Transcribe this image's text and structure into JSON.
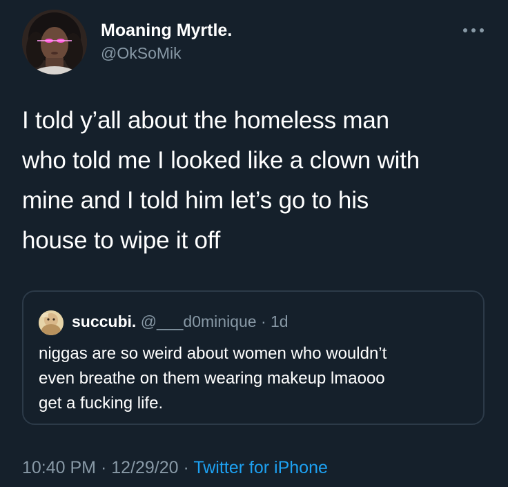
{
  "tweet": {
    "author_name": "Moaning Myrtle.",
    "author_handle": "@OkSoMik",
    "text_lines": [
      "I told y’all about the homeless man",
      "who told me I looked like a clown with",
      "mine and I told him let’s go to his",
      "house to wipe it off"
    ],
    "more_icon": "more-horizontal-icon",
    "timestamp_time": "10:40 PM",
    "separator": "·",
    "timestamp_date": "12/29/20",
    "source": "Twitter for iPhone"
  },
  "quoted": {
    "author_name": "succubi.",
    "author_handle": "@___d0minique",
    "separator": "·",
    "time": "1d",
    "text_lines": [
      "niggas are so weird about women who wouldn’t",
      "even breathe on them wearing makeup lmaooo",
      "get a fucking life."
    ]
  },
  "colors": {
    "background": "#15202b",
    "primary_text": "#ffffff",
    "secondary_text": "#8899a6",
    "link": "#1da1f2",
    "border": "#2c3a48"
  }
}
